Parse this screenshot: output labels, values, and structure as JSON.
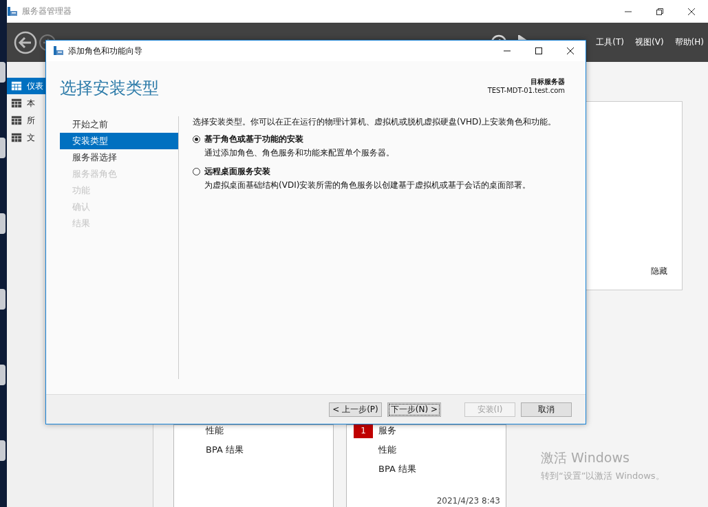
{
  "server_manager": {
    "title": "服务器管理器",
    "menu": [
      "工具(T)",
      "视图(V)",
      "帮助(H)"
    ],
    "sidebar": {
      "items": [
        {
          "label": "仪表",
          "selected": true
        },
        {
          "label": "本",
          "selected": false
        },
        {
          "label": "所",
          "selected": false
        },
        {
          "label": "文",
          "selected": false
        }
      ]
    },
    "panel": {
      "hide_link": "隐藏"
    },
    "tiles": [
      {
        "items": [
          "性能",
          "BPA 结果"
        ]
      },
      {
        "badge": "1",
        "items": [
          "服务",
          "性能",
          "BPA 结果"
        ],
        "timestamp": "2021/4/23 8:43"
      }
    ]
  },
  "activation": {
    "title": "激活 Windows",
    "subtitle": "转到“设置”以激活 Windows。"
  },
  "wizard": {
    "title": "添加角色和功能向导",
    "heading": "选择安装类型",
    "target_label": "目标服务器",
    "target_server": "TEST-MDT-01.test.com",
    "steps": [
      {
        "label": "开始之前",
        "selected": false,
        "disabled": false
      },
      {
        "label": "安装类型",
        "selected": true,
        "disabled": false
      },
      {
        "label": "服务器选择",
        "selected": false,
        "disabled": false
      },
      {
        "label": "服务器角色",
        "selected": false,
        "disabled": true
      },
      {
        "label": "功能",
        "selected": false,
        "disabled": true
      },
      {
        "label": "确认",
        "selected": false,
        "disabled": true
      },
      {
        "label": "结果",
        "selected": false,
        "disabled": true
      }
    ],
    "intro": "选择安装类型。你可以在正在运行的物理计算机、虚拟机或脱机虚拟硬盘(VHD)上安装角色和功能。",
    "options": [
      {
        "label": "基于角色或基于功能的安装",
        "description": "通过添加角色、角色服务和功能来配置单个服务器。",
        "selected": true
      },
      {
        "label": "远程桌面服务安装",
        "description": "为虚拟桌面基础结构(VDI)安装所需的角色服务以创建基于虚拟机或基于会话的桌面部署。",
        "selected": false
      }
    ],
    "buttons": [
      {
        "label": "< 上一步(P)",
        "disabled": false,
        "focused": false
      },
      {
        "label": "下一步(N) >",
        "disabled": false,
        "focused": true
      },
      {
        "label": "安装(I)",
        "disabled": true,
        "focused": false
      },
      {
        "label": "取消",
        "disabled": false,
        "focused": false
      }
    ]
  }
}
